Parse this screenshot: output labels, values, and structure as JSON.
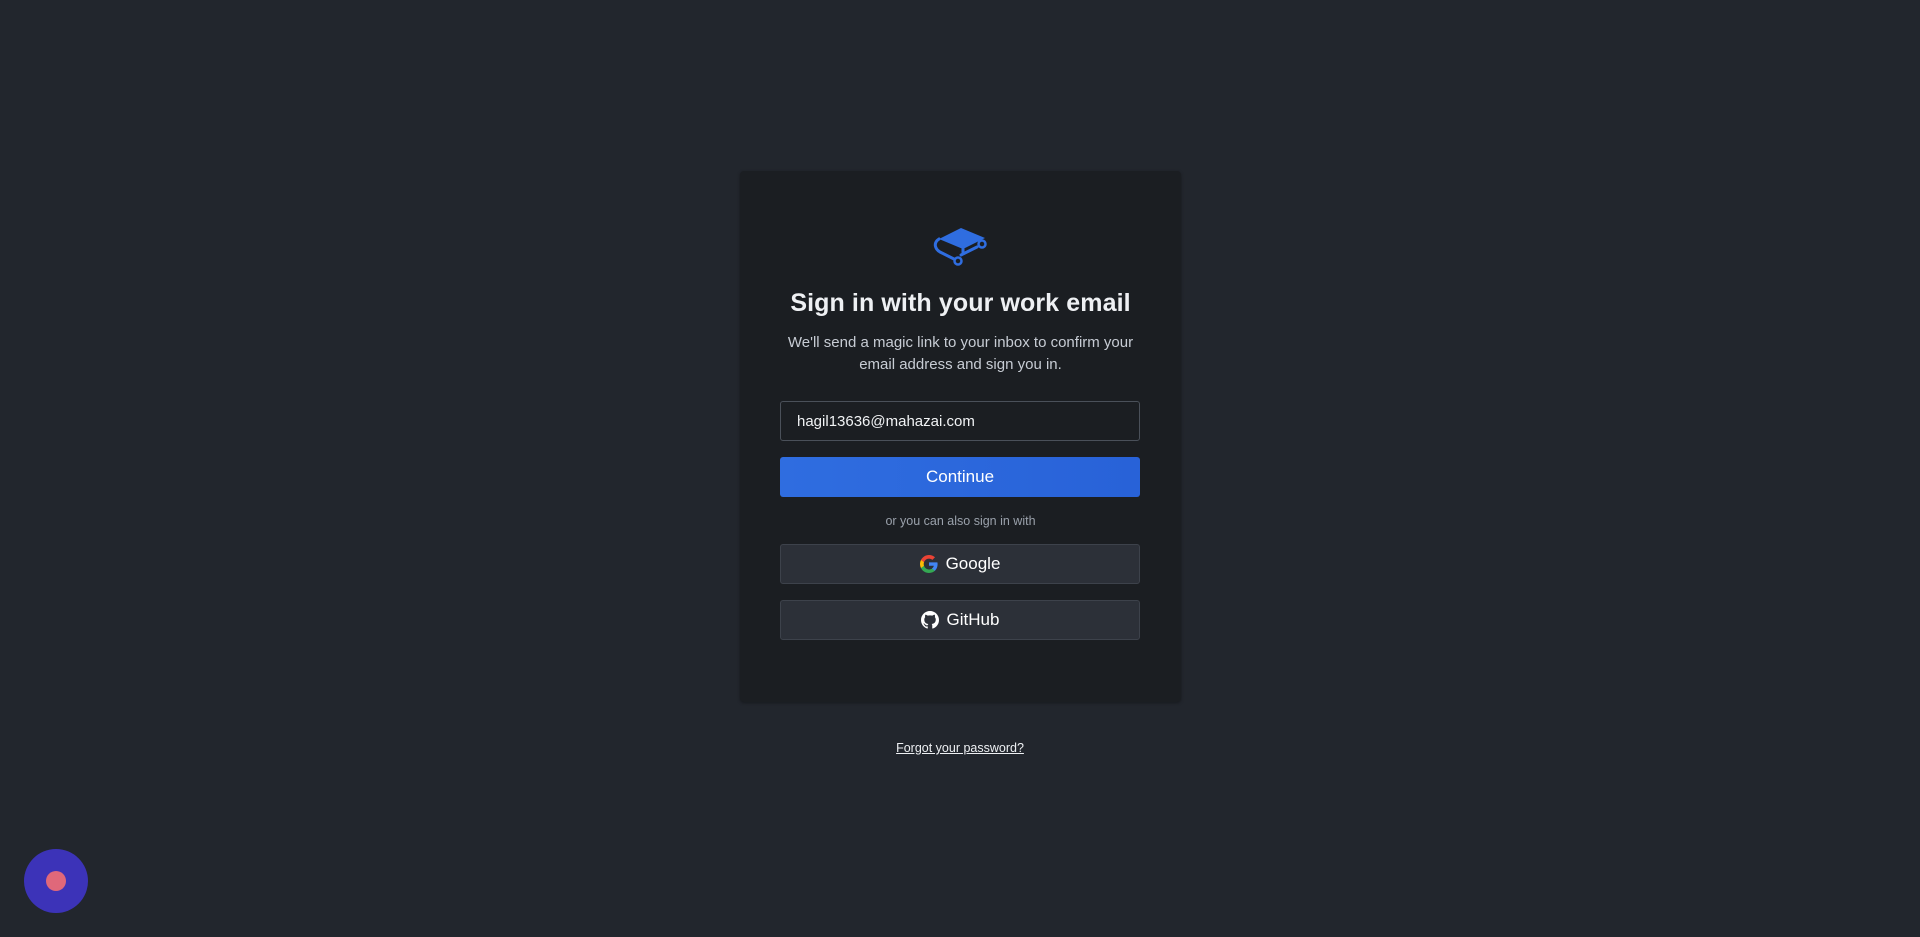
{
  "auth": {
    "logo_icon": "book-network-icon",
    "title": "Sign in with your work email",
    "subtitle": "We'll send a magic link to your inbox to confirm your email address and sign you in.",
    "email_value": "hagil13636@mahazai.com",
    "continue_label": "Continue",
    "divider_text": "or you can also sign in with",
    "google_label": "Google",
    "google_icon": "google-icon",
    "github_label": "GitHub",
    "github_icon": "github-icon"
  },
  "footer": {
    "forgot_label": "Forgot your password?"
  },
  "widget": {
    "icon": "record-dot-icon"
  },
  "colors": {
    "background": "#22262d",
    "card": "#1b1e22",
    "primary": "#2f6de0",
    "social_button": "#2c3038",
    "fab": "#3c33b8",
    "fab_dot": "#e0687a"
  }
}
